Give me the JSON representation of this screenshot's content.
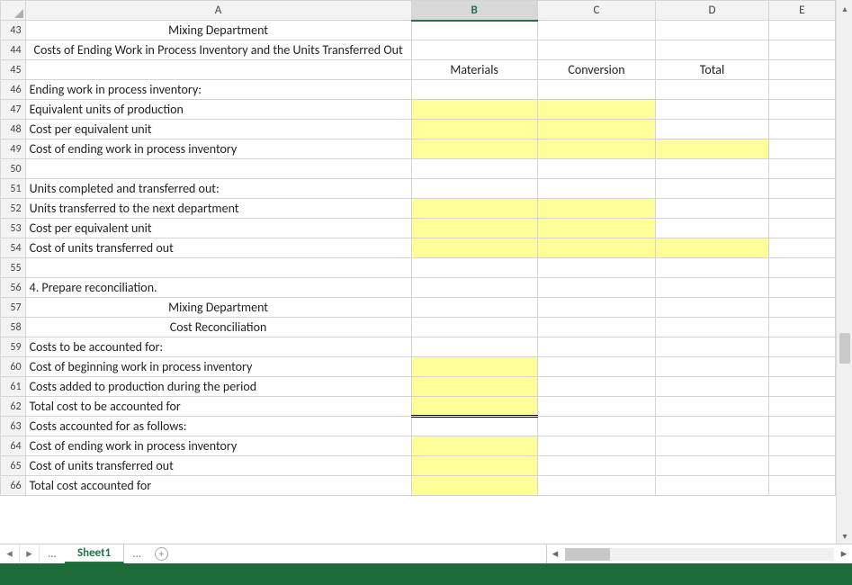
{
  "columns": {
    "A": "A",
    "B": "B",
    "C": "C",
    "D": "D",
    "E": "E"
  },
  "selected_column": "B",
  "row_start": 43,
  "headers": {
    "materials": "Materials",
    "conversion": "Conversion",
    "total": "Total"
  },
  "titles": {
    "dept": "Mixing Department",
    "report": "Costs of Ending Work in Process Inventory and the Units Transferred Out",
    "section4": "4. Prepare reconciliation.",
    "dept2": "Mixing Department",
    "recon": "Cost Reconciliation"
  },
  "labels": {
    "ewip_hdr": "Ending work in process inventory:",
    "equiv_units": "Equivalent units of production",
    "cost_per_eu": "Cost per equivalent unit",
    "cost_ewip": "Cost of ending work in process inventory",
    "completed_hdr": "Units completed and transferred out:",
    "units_transferred": "Units transferred to the next department",
    "cost_per_eu2": "Cost per equivalent unit",
    "cost_transferred": "Cost of units transferred out",
    "costs_acct_for_hdr": "Costs to be accounted for:",
    "beg_wip": "Cost of beginning work in process inventory",
    "costs_added": "Costs added to production during the period",
    "total_cost_acct": "Total cost to be accounted for",
    "costs_acct_follows": "Costs accounted for as follows:",
    "cost_ewip2": "Cost of ending work in process inventory",
    "cost_transferred2": "Cost of units transferred out",
    "total_cost_acct_for": "Total cost accounted for"
  },
  "sheet_tab": "Sheet1",
  "chart_data": null
}
